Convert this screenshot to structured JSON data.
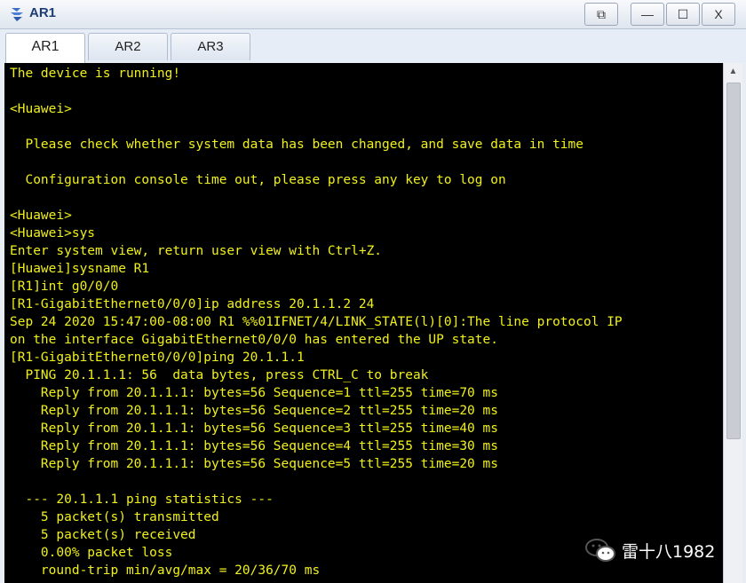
{
  "window": {
    "title": "AR1",
    "buttons": {
      "restore_label": "⧉",
      "minimize_label": "—",
      "maximize_label": "☐",
      "close_label": "X"
    }
  },
  "tabs": [
    {
      "label": "AR1",
      "active": true
    },
    {
      "label": "AR2",
      "active": false
    },
    {
      "label": "AR3",
      "active": false
    }
  ],
  "terminal": {
    "text_color": "#f0f01a",
    "background": "#000000",
    "lines": [
      "The device is running!",
      "",
      "<Huawei>",
      "",
      "  Please check whether system data has been changed, and save data in time",
      "",
      "  Configuration console time out, please press any key to log on",
      "",
      "<Huawei>",
      "<Huawei>sys",
      "Enter system view, return user view with Ctrl+Z.",
      "[Huawei]sysname R1",
      "[R1]int g0/0/0",
      "[R1-GigabitEthernet0/0/0]ip address 20.1.1.2 24",
      "Sep 24 2020 15:47:00-08:00 R1 %%01IFNET/4/LINK_STATE(l)[0]:The line protocol IP",
      "on the interface GigabitEthernet0/0/0 has entered the UP state.",
      "[R1-GigabitEthernet0/0/0]ping 20.1.1.1",
      "  PING 20.1.1.1: 56  data bytes, press CTRL_C to break",
      "    Reply from 20.1.1.1: bytes=56 Sequence=1 ttl=255 time=70 ms",
      "    Reply from 20.1.1.1: bytes=56 Sequence=2 ttl=255 time=20 ms",
      "    Reply from 20.1.1.1: bytes=56 Sequence=3 ttl=255 time=40 ms",
      "    Reply from 20.1.1.1: bytes=56 Sequence=4 ttl=255 time=30 ms",
      "    Reply from 20.1.1.1: bytes=56 Sequence=5 ttl=255 time=20 ms",
      "",
      "  --- 20.1.1.1 ping statistics ---",
      "    5 packet(s) transmitted",
      "    5 packet(s) received",
      "    0.00% packet loss",
      "    round-trip min/avg/max = 20/36/70 ms"
    ]
  },
  "scrollbar": {
    "up_arrow_icon": "triangle-up-icon"
  },
  "watermark": {
    "text": "雷十八1982",
    "icon": "wechat-icon"
  }
}
